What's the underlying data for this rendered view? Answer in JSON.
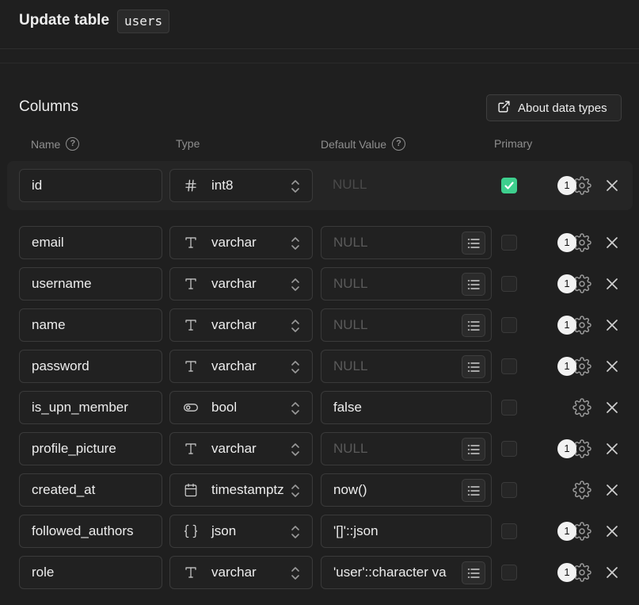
{
  "header": {
    "title": "Update table",
    "table_name": "users"
  },
  "columns_section": {
    "title": "Columns",
    "about_button": "About data types",
    "headers": {
      "name": "Name",
      "type": "Type",
      "default": "Default Value",
      "primary": "Primary"
    }
  },
  "rows": [
    {
      "name": "id",
      "type": "int8",
      "type_icon": "hash-icon",
      "default": "NULL",
      "default_is_placeholder": true,
      "default_has_list": false,
      "primary": true,
      "badge": "1"
    },
    {
      "name": "email",
      "type": "varchar",
      "type_icon": "text-icon",
      "default": "NULL",
      "default_is_placeholder": true,
      "default_has_list": true,
      "primary": false,
      "badge": "1"
    },
    {
      "name": "username",
      "type": "varchar",
      "type_icon": "text-icon",
      "default": "NULL",
      "default_is_placeholder": true,
      "default_has_list": true,
      "primary": false,
      "badge": "1"
    },
    {
      "name": "name",
      "type": "varchar",
      "type_icon": "text-icon",
      "default": "NULL",
      "default_is_placeholder": true,
      "default_has_list": true,
      "primary": false,
      "badge": "1"
    },
    {
      "name": "password",
      "type": "varchar",
      "type_icon": "text-icon",
      "default": "NULL",
      "default_is_placeholder": true,
      "default_has_list": true,
      "primary": false,
      "badge": "1"
    },
    {
      "name": "is_upn_member",
      "type": "bool",
      "type_icon": "toggle-icon",
      "default": "false",
      "default_is_placeholder": false,
      "default_has_list": false,
      "primary": false,
      "badge": ""
    },
    {
      "name": "profile_picture",
      "type": "varchar",
      "type_icon": "text-icon",
      "default": "NULL",
      "default_is_placeholder": true,
      "default_has_list": true,
      "primary": false,
      "badge": "1"
    },
    {
      "name": "created_at",
      "type": "timestamptz",
      "type_icon": "calendar-icon",
      "default": "now()",
      "default_is_placeholder": false,
      "default_has_list": true,
      "primary": false,
      "badge": ""
    },
    {
      "name": "followed_authors",
      "type": "json",
      "type_icon": "braces-icon",
      "default": "'[]'::json",
      "default_is_placeholder": false,
      "default_has_list": false,
      "primary": false,
      "badge": "1"
    },
    {
      "name": "role",
      "type": "varchar",
      "type_icon": "text-icon",
      "default": "'user'::character va",
      "default_is_placeholder": false,
      "default_has_list": true,
      "primary": false,
      "badge": "1"
    }
  ],
  "colors": {
    "primary_check": "#3ecf8e",
    "background": "#1f1f1f"
  }
}
